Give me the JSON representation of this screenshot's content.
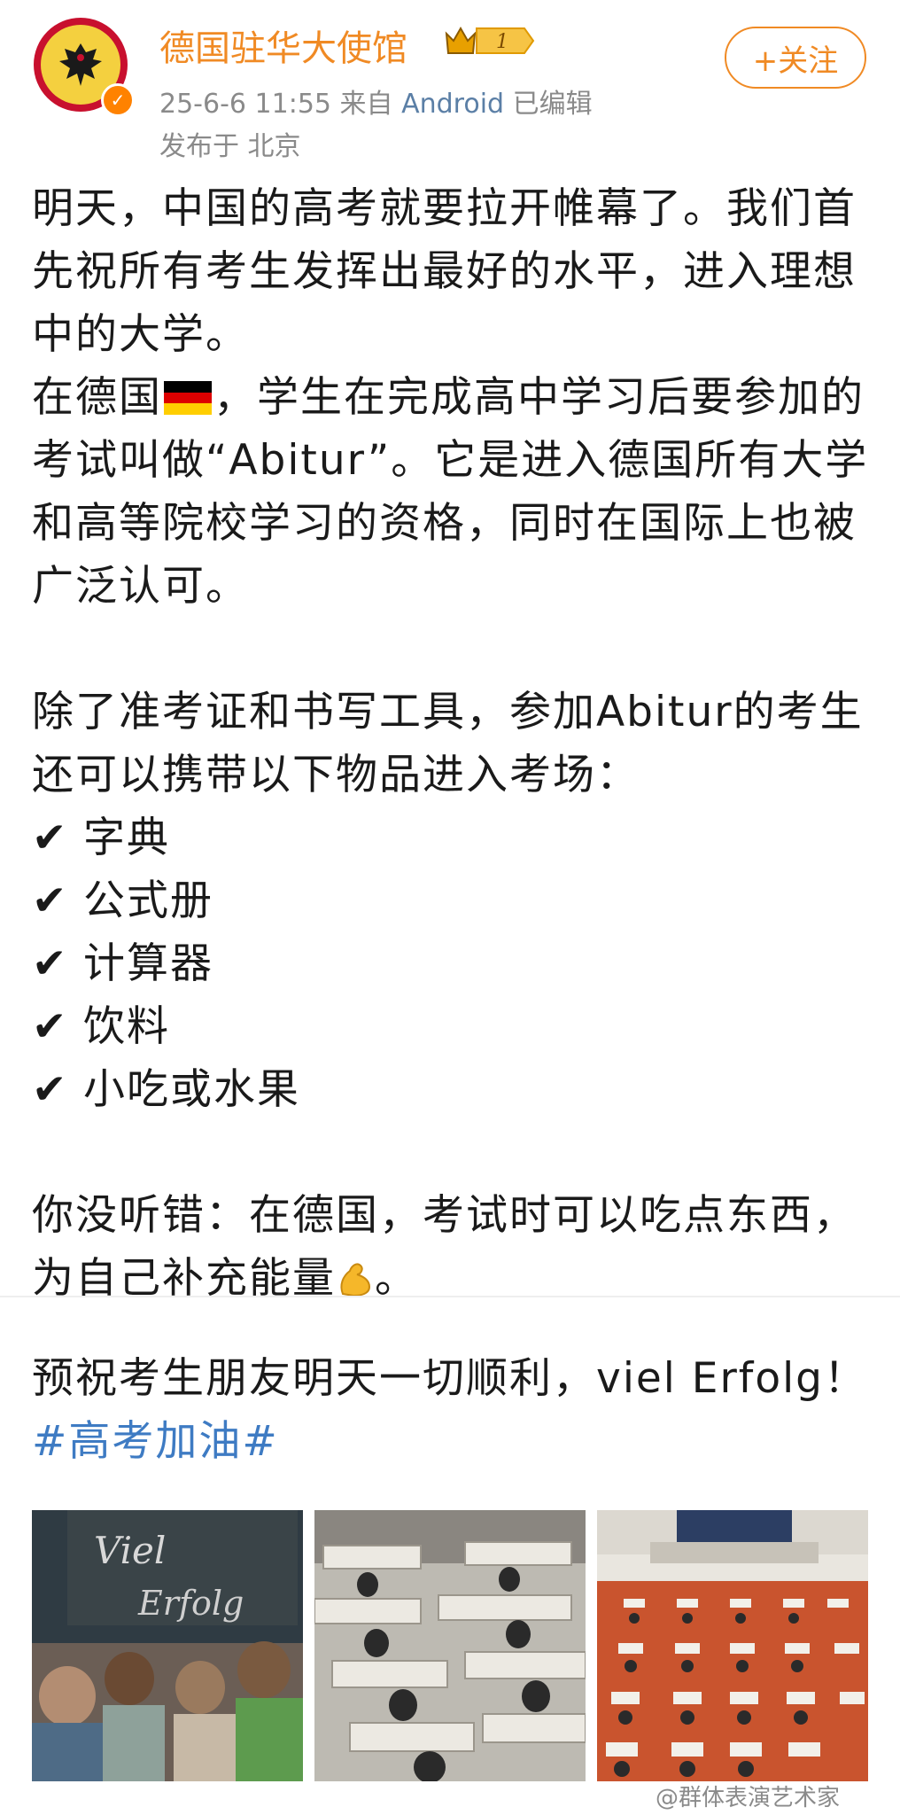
{
  "post": {
    "author": "德国驻华大使馆",
    "level_badge": "1",
    "follow_label": "+关注",
    "date": "25-6-6 11:55",
    "from_label": "来自",
    "source": "Android",
    "edited": "已编辑",
    "location": "发布于 北京"
  },
  "content": {
    "p1": "明天，中国的高考就要拉开帷幕了。我们首先祝所有考生发挥出最好的水平，进入理想中的大学。",
    "p2a": "在德国",
    "p2b": "，学生在完成高中学习后要参加的考试叫做“Abitur”。它是进入德国所有大学和高等院校学习的资格，同时在国际上也被广泛认可。",
    "p3": "除了准考证和书写工具，参加Abitur的考生还可以携带以下物品进入考场：",
    "checks": [
      "字典",
      "公式册",
      "计算器",
      "饮料",
      "小吃或水果"
    ],
    "p4a": "你没听错：在德国，考试时可以吃点东西，为自己补充能量",
    "p4b": "。",
    "p5": "预祝考生朋友明天一切顺利，viel Erfolg！",
    "hashtag": "#高考加油#"
  },
  "images": {
    "chalk_line1": "Viel",
    "chalk_line2": "Erfolg"
  },
  "watermark": "@群体表演艺术家",
  "icons": {
    "check": "checkmark-icon",
    "flag": "german-flag-icon",
    "muscle": "flexed-biceps-icon",
    "crown": "crown-icon",
    "verified": "verified-icon"
  },
  "colors": {
    "author": "#f08a24",
    "link": "#3e7bc3",
    "meta": "#8a8a8a",
    "source": "#5b7fa6"
  }
}
